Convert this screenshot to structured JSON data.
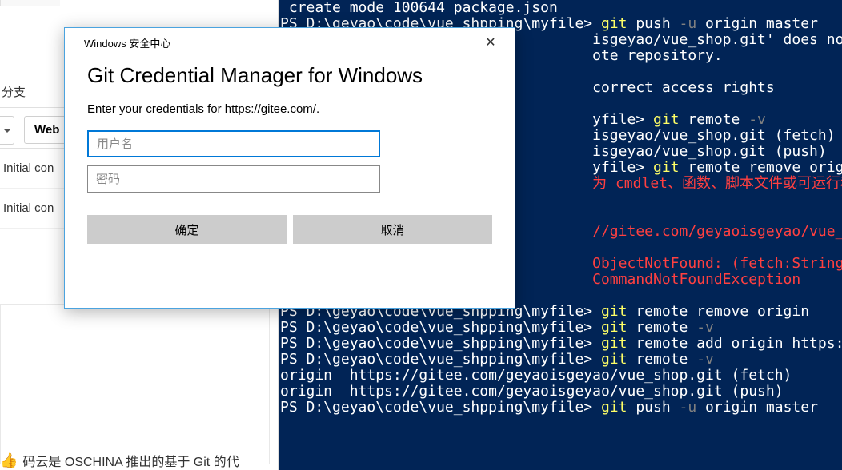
{
  "left_panel": {
    "branch": "分支",
    "web_btn": "Web",
    "initial_rows": [
      "Initial con",
      "Initial con"
    ],
    "footer": "码云是 OSCHINA 推出的基于 Git 的代"
  },
  "terminal": {
    "lines": [
      {
        "segs": [
          {
            "c": "white",
            "t": " create mode 100644 package.json"
          }
        ]
      },
      {
        "segs": [
          {
            "c": "white",
            "t": "PS D:\\geyao\\code\\vue_shpping\\myfile> "
          },
          {
            "c": "yellow",
            "t": "git"
          },
          {
            "c": "white",
            "t": " push "
          },
          {
            "c": "darkgray",
            "t": "-u"
          },
          {
            "c": "white",
            "t": " origin master"
          }
        ]
      },
      {
        "segs": [
          {
            "c": "white",
            "t": "                                    isgeyao/vue_shop.git' does not appear to "
          }
        ]
      },
      {
        "segs": [
          {
            "c": "white",
            "t": "                                    ote repository."
          }
        ]
      },
      {
        "segs": [
          {
            "c": "white",
            "t": ""
          }
        ]
      },
      {
        "segs": [
          {
            "c": "white",
            "t": "                                    correct access rights"
          }
        ]
      },
      {
        "segs": [
          {
            "c": "white",
            "t": ""
          }
        ]
      },
      {
        "segs": [
          {
            "c": "white",
            "t": "                                    yfile> "
          },
          {
            "c": "yellow",
            "t": "git"
          },
          {
            "c": "white",
            "t": " remote "
          },
          {
            "c": "darkgray",
            "t": "-v"
          }
        ]
      },
      {
        "segs": [
          {
            "c": "white",
            "t": "                                    isgeyao/vue_shop.git (fetch)"
          }
        ]
      },
      {
        "segs": [
          {
            "c": "white",
            "t": "                                    isgeyao/vue_shop.git (push)"
          }
        ]
      },
      {
        "segs": [
          {
            "c": "white",
            "t": "                                    yfile> "
          },
          {
            "c": "yellow",
            "t": "git"
          },
          {
            "c": "white",
            "t": " remote remove origin https://gi"
          }
        ]
      },
      {
        "segs": [
          {
            "c": "red",
            "t": "                                    为 cmdlet、函数、脚本文件或可运行程序的名称"
          }
        ]
      },
      {
        "segs": [
          {
            "c": "red",
            "t": ""
          }
        ]
      },
      {
        "segs": [
          {
            "c": "red",
            "t": ""
          }
        ]
      },
      {
        "segs": [
          {
            "c": "red",
            "t": "                                    //gitee.com/geyaoisgeyao/vue_shop.git (fe"
          }
        ]
      },
      {
        "segs": [
          {
            "c": "red",
            "t": ""
          }
        ]
      },
      {
        "segs": [
          {
            "c": "red",
            "t": "                                    ObjectNotFound: (fetch:String) [], Comman"
          }
        ]
      },
      {
        "segs": [
          {
            "c": "red",
            "t": "                                    CommandNotFoundException"
          }
        ]
      },
      {
        "segs": [
          {
            "c": "red",
            "t": ""
          }
        ]
      },
      {
        "segs": [
          {
            "c": "white",
            "t": "PS D:\\geyao\\code\\vue_shpping\\myfile> "
          },
          {
            "c": "yellow",
            "t": "git"
          },
          {
            "c": "white",
            "t": " remote remove origin"
          }
        ]
      },
      {
        "segs": [
          {
            "c": "white",
            "t": "PS D:\\geyao\\code\\vue_shpping\\myfile> "
          },
          {
            "c": "yellow",
            "t": "git"
          },
          {
            "c": "white",
            "t": " remote "
          },
          {
            "c": "darkgray",
            "t": "-v"
          }
        ]
      },
      {
        "segs": [
          {
            "c": "white",
            "t": "PS D:\\geyao\\code\\vue_shpping\\myfile> "
          },
          {
            "c": "yellow",
            "t": "git"
          },
          {
            "c": "white",
            "t": " remote add origin https://gite"
          }
        ]
      },
      {
        "segs": [
          {
            "c": "white",
            "t": "PS D:\\geyao\\code\\vue_shpping\\myfile> "
          },
          {
            "c": "yellow",
            "t": "git"
          },
          {
            "c": "white",
            "t": " remote "
          },
          {
            "c": "darkgray",
            "t": "-v"
          }
        ]
      },
      {
        "segs": [
          {
            "c": "white",
            "t": "origin  https://gitee.com/geyaoisgeyao/vue_shop.git (fetch)"
          }
        ]
      },
      {
        "segs": [
          {
            "c": "white",
            "t": "origin  https://gitee.com/geyaoisgeyao/vue_shop.git (push)"
          }
        ]
      },
      {
        "segs": [
          {
            "c": "white",
            "t": "PS D:\\geyao\\code\\vue_shpping\\myfile> "
          },
          {
            "c": "yellow",
            "t": "git"
          },
          {
            "c": "white",
            "t": " push "
          },
          {
            "c": "darkgray",
            "t": "-u"
          },
          {
            "c": "white",
            "t": " origin master"
          }
        ]
      }
    ]
  },
  "dialog": {
    "titlebar": "Windows 安全中心",
    "heading": "Git Credential Manager for Windows",
    "subtext": "Enter your credentials for https://gitee.com/.",
    "username_placeholder": "用户名",
    "password_placeholder": "密码",
    "ok_btn": "确定",
    "cancel_btn": "取消"
  }
}
